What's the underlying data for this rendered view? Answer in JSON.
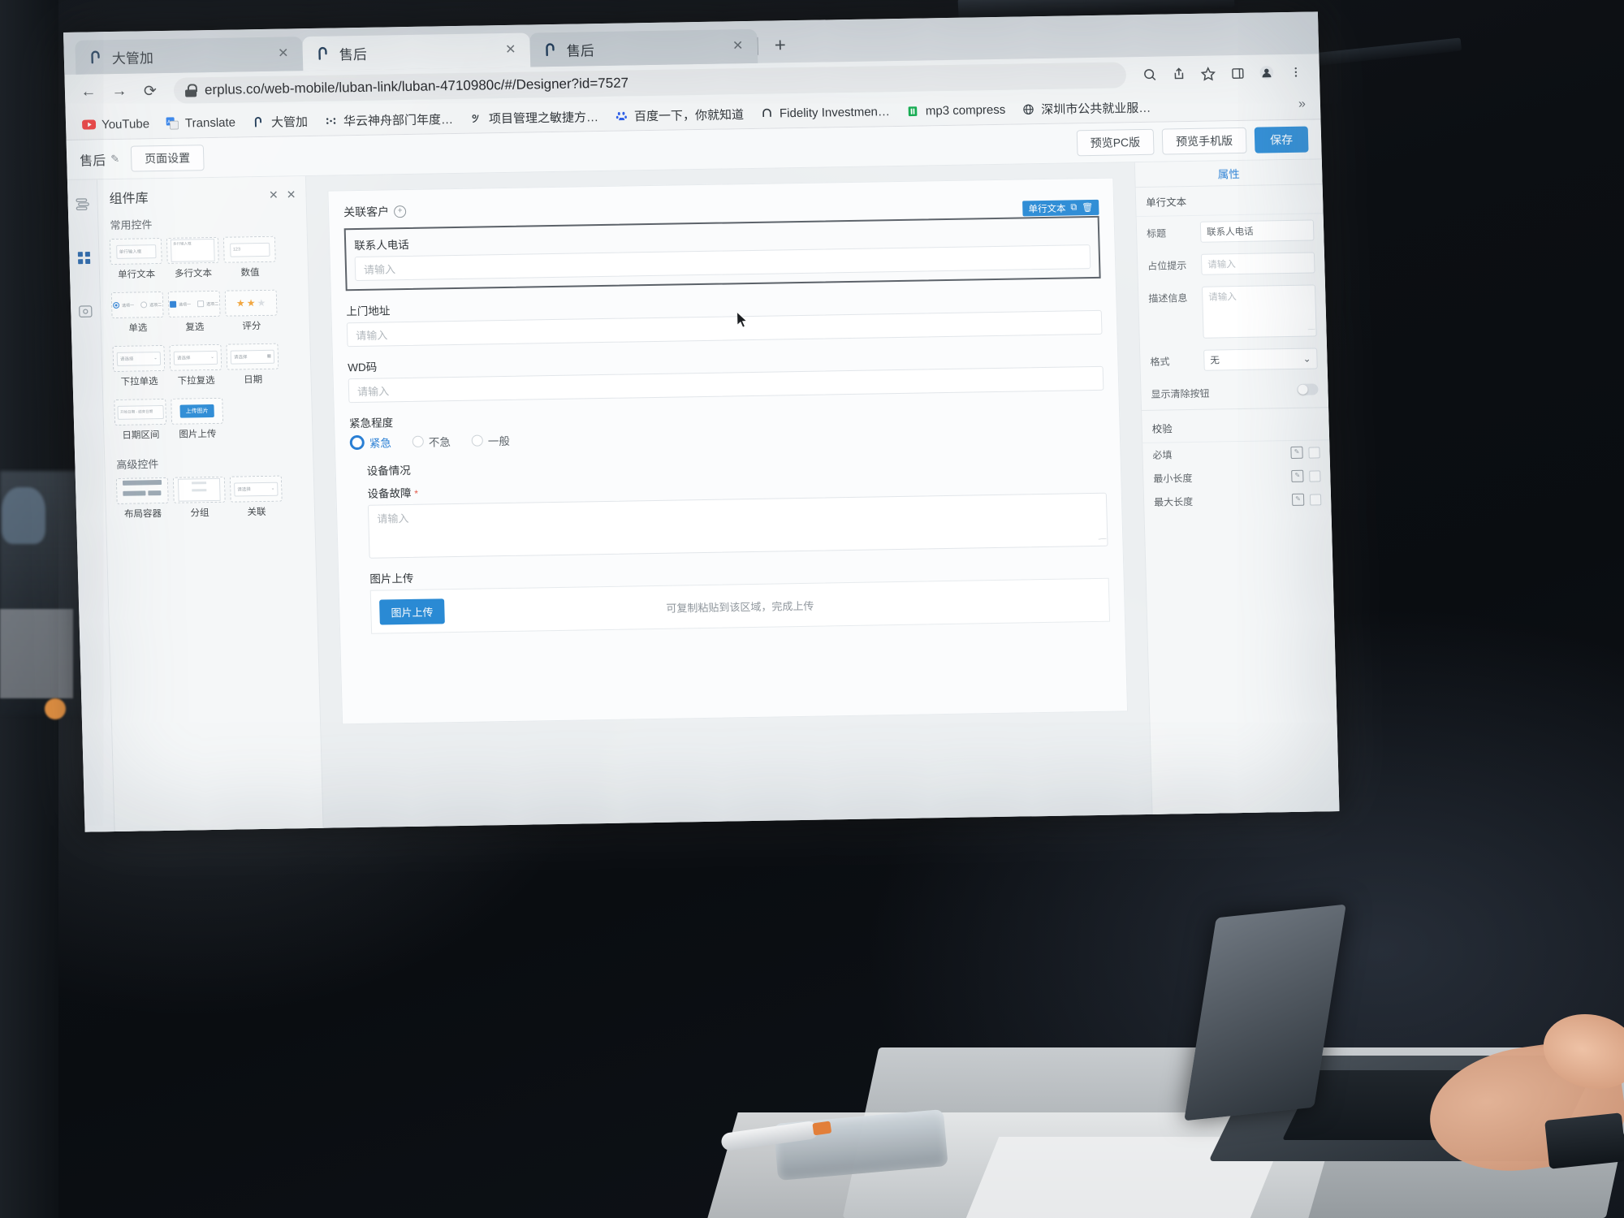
{
  "browser": {
    "tabs": [
      {
        "title": "大管加",
        "active": false,
        "close": "✕"
      },
      {
        "title": "售后",
        "active": true,
        "close": "✕"
      },
      {
        "title": "售后",
        "active": false,
        "close": "✕"
      }
    ],
    "new_tab_label": "+",
    "nav": {
      "back": "←",
      "forward": "→",
      "reload": "⟳",
      "url": "erplus.co/web-mobile/luban-link/luban-4710980c/#/Designer?id=7527",
      "lock_icon": "lock-icon"
    },
    "toolbar_icons": [
      "search-icon",
      "share-icon",
      "bookmark-star-icon",
      "side-panel-icon",
      "profile-avatar-icon",
      "chrome-menu-icon"
    ],
    "bookmarks": [
      {
        "label": "YouTube",
        "icon": "youtube-icon"
      },
      {
        "label": "Translate",
        "icon": "google-translate-icon"
      },
      {
        "label": "大管加",
        "icon": "daguanjia-icon"
      },
      {
        "label": "华云神舟部门年度…",
        "icon": "dots-icon"
      },
      {
        "label": "项目管理之敏捷方…",
        "icon": "agile-icon"
      },
      {
        "label": "百度一下，你就知道",
        "icon": "baidu-icon"
      },
      {
        "label": "Fidelity Investmen…",
        "icon": "fidelity-icon"
      },
      {
        "label": "mp3 compress",
        "icon": "mp3-icon"
      },
      {
        "label": "深圳市公共就业服…",
        "icon": "globe-icon"
      }
    ],
    "bookmarks_overflow": "»"
  },
  "appbar": {
    "title": "售后",
    "edit_icon": "pencil-icon",
    "page_settings": "页面设置",
    "preview_pc": "预览PC版",
    "preview_mobile": "预览手机版",
    "save": "保存"
  },
  "rail": {
    "items": [
      {
        "name": "outline-icon"
      },
      {
        "name": "components-grid-icon"
      },
      {
        "name": "data-source-icon"
      }
    ]
  },
  "component_library": {
    "title": "组件库",
    "pin_icon": "pin-icon",
    "close_icon": "close-icon",
    "sections": [
      {
        "title": "常用控件",
        "items": [
          {
            "label": "单行文本",
            "preview": "单行输入框"
          },
          {
            "label": "多行文本",
            "preview": "多行输入框"
          },
          {
            "label": "数值",
            "preview": "123"
          },
          {
            "label": "单选",
            "opt1": "选项一",
            "opt2": "选项二"
          },
          {
            "label": "复选",
            "opt1": "选项一",
            "opt2": "选项二"
          },
          {
            "label": "评分",
            "preview": "★★★"
          },
          {
            "label": "下拉单选",
            "preview": "请选择"
          },
          {
            "label": "下拉复选",
            "preview": "请选择"
          },
          {
            "label": "日期",
            "preview": "请选择"
          },
          {
            "label": "日期区间",
            "preview": "开始日期 - 结束日期"
          },
          {
            "label": "图片上传",
            "preview": "上传图片"
          }
        ]
      },
      {
        "title": "高级控件",
        "items": [
          {
            "label": "布局容器",
            "preview": ""
          },
          {
            "label": "分组",
            "preview": ""
          },
          {
            "label": "关联",
            "preview": "请选择"
          }
        ]
      }
    ]
  },
  "canvas": {
    "group_title": "关联客户",
    "group_add_icon": "plus-circle-icon",
    "selected_badge": {
      "type": "单行文本",
      "copy_icon": "copy-icon",
      "delete_icon": "trash-icon"
    },
    "fields": [
      {
        "label": "联系人电话",
        "placeholder": "请输入",
        "selected": true,
        "required": false
      },
      {
        "label": "上门地址",
        "placeholder": "请输入",
        "selected": false,
        "required": false
      },
      {
        "label": "WD码",
        "placeholder": "请输入",
        "selected": false,
        "required": false
      }
    ],
    "radio_field": {
      "label": "紧急程度",
      "options": [
        {
          "label": "紧急",
          "selected": true
        },
        {
          "label": "不急",
          "selected": false
        },
        {
          "label": "一般",
          "selected": false
        }
      ]
    },
    "group2": {
      "title": "设备情况",
      "textarea": {
        "label": "设备故障",
        "required_mark": "*",
        "placeholder": "请输入"
      },
      "upload": {
        "label": "图片上传",
        "button": "图片上传",
        "hint": "可复制粘贴到该区域，完成上传"
      }
    }
  },
  "properties": {
    "tab": "属性",
    "component_type": "单行文本",
    "rows": [
      {
        "label": "标题",
        "value": "联系人电话",
        "kind": "input"
      },
      {
        "label": "占位提示",
        "value": "请输入",
        "kind": "input-placeholder"
      },
      {
        "label": "描述信息",
        "value": "请输入",
        "kind": "textarea"
      },
      {
        "label": "格式",
        "value": "无",
        "kind": "select"
      },
      {
        "label": "显示清除按钮",
        "value": "",
        "kind": "toggle",
        "toggle_on": false
      }
    ],
    "validation": {
      "title": "校验",
      "items": [
        {
          "label": "必填",
          "edit_icon": "edit-icon",
          "checked": false
        },
        {
          "label": "最小长度",
          "edit_icon": "edit-icon",
          "checked": false
        },
        {
          "label": "最大长度",
          "edit_icon": "edit-icon",
          "checked": false
        }
      ]
    }
  },
  "colors": {
    "accent": "#2a8ad4",
    "selected_border": "#5a6067",
    "required": "#e35a4a"
  }
}
